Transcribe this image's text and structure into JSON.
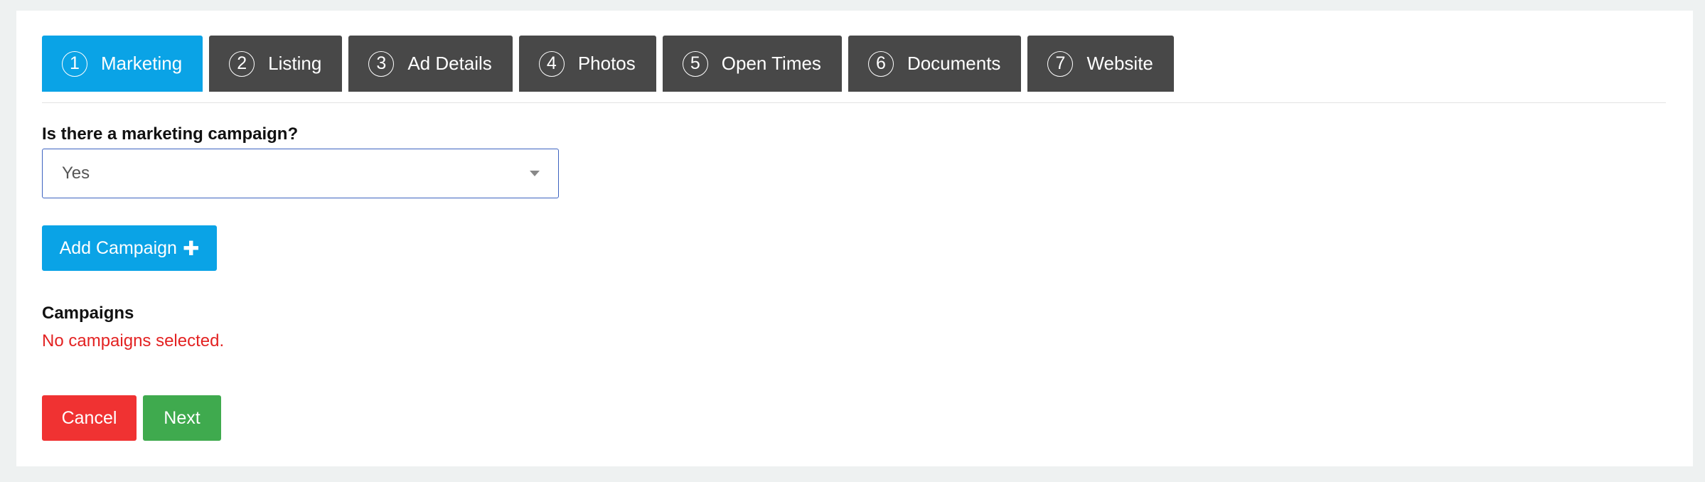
{
  "tabs": [
    {
      "num": "1",
      "label": "Marketing",
      "active": true
    },
    {
      "num": "2",
      "label": "Listing",
      "active": false
    },
    {
      "num": "3",
      "label": "Ad Details",
      "active": false
    },
    {
      "num": "4",
      "label": "Photos",
      "active": false
    },
    {
      "num": "5",
      "label": "Open Times",
      "active": false
    },
    {
      "num": "6",
      "label": "Documents",
      "active": false
    },
    {
      "num": "7",
      "label": "Website",
      "active": false
    }
  ],
  "marketing": {
    "question_label": "Is there a marketing campaign?",
    "selected_value": "Yes",
    "add_campaign_label": "Add Campaign",
    "add_campaign_icon": "plus-icon",
    "campaigns_heading": "Campaigns",
    "empty_message": "No campaigns selected."
  },
  "actions": {
    "cancel_label": "Cancel",
    "next_label": "Next"
  },
  "colors": {
    "accent": "#0aa3e6",
    "tab_inactive": "#484848",
    "danger": "#f03232",
    "success": "#3faa4e",
    "error_text": "#e32222"
  }
}
